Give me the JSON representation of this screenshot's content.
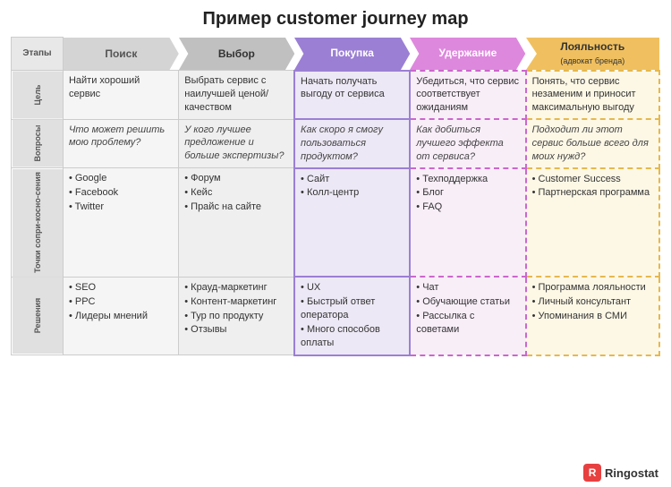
{
  "title": "Пример customer journey map",
  "stages": {
    "label": "Этапы",
    "items": [
      {
        "label": "Поиск",
        "type": "gray-light",
        "color": "#d4d4d4",
        "textColor": "#555"
      },
      {
        "label": "Выбор",
        "type": "gray",
        "color": "#b8b8b8",
        "textColor": "#333"
      },
      {
        "label": "Покупка",
        "type": "purple",
        "color": "#9b7fd4",
        "textColor": "#fff"
      },
      {
        "label": "Удержание",
        "type": "pink",
        "color": "#dd88dd",
        "textColor": "#fff"
      },
      {
        "label": "Лояльность",
        "sub": "(адвокат бренда)",
        "type": "yellow",
        "color": "#f0c060",
        "textColor": "#333"
      }
    ]
  },
  "rows": [
    {
      "label": "Цель",
      "cells": [
        "Найти хороший сервис",
        "Выбрать сервис с наилучшей ценой/качеством",
        "Начать получать выгоду от сервиса",
        "Убедиться, что сервис соответствует ожиданиям",
        "Понять, что сервис незаменим и приносит максимальную выгоду"
      ]
    },
    {
      "label": "Вопросы",
      "cells": [
        "Что может решить мою проблему?",
        "У кого лучшее предложение и больше экспертизы?",
        "Как скоро я смогу пользоваться продуктом?",
        "Как добиться лучшего эффекта от сервиса?",
        "Подходит ли этот сервис больше всего для моих нужд?"
      ],
      "italic": true
    },
    {
      "label": "Точки сопри-косно-сения",
      "cells": [
        [
          "Google",
          "Facebook",
          "Twitter"
        ],
        [
          "Форум",
          "Кейс",
          "Прайс на сайте"
        ],
        [
          "Сайт",
          "Колл-центр"
        ],
        [
          "Техподдержка",
          "Блог",
          "FAQ"
        ],
        [
          "Customer Success",
          "Партнерская программа"
        ]
      ],
      "isList": true
    },
    {
      "label": "Решения",
      "cells": [
        [
          "SEO",
          "PPC",
          "Лидеры мнений"
        ],
        [
          "Крауд-маркетинг",
          "Контент-маркетинг",
          "Тур по продукту",
          "Отзывы"
        ],
        [
          "UX",
          "Быстрый ответ оператора",
          "Много способов оплаты"
        ],
        [
          "Чат",
          "Обучающие статьи",
          "Рассылка с советами"
        ],
        [
          "Программа лояльности",
          "Личный консультант",
          "Упоминания в СМИ"
        ]
      ],
      "isList": true
    }
  ],
  "logo": {
    "text": "Ringostat"
  }
}
